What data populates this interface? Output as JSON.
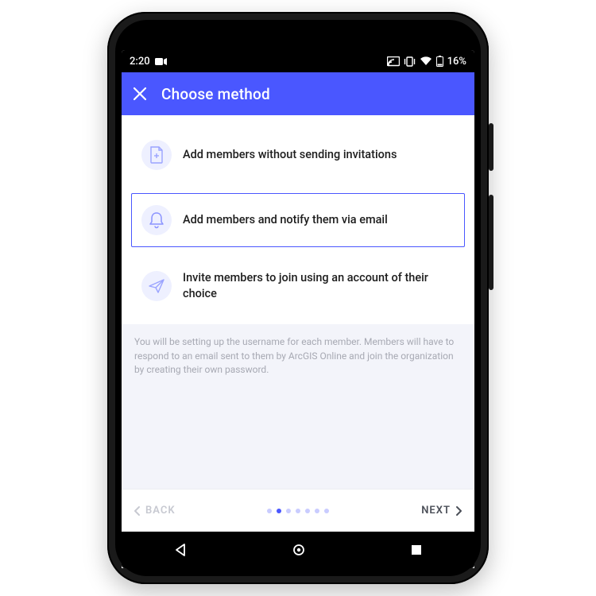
{
  "statusbar": {
    "time": "2:20",
    "battery_text": "16%"
  },
  "appbar": {
    "title": "Choose method"
  },
  "options": [
    {
      "label": "Add members without sending invitations",
      "selected": false,
      "icon": "file-plus-icon"
    },
    {
      "label": "Add members and notify them via email",
      "selected": true,
      "icon": "bell-icon"
    },
    {
      "label": "Invite members to join using an account of their choice",
      "selected": false,
      "icon": "paper-plane-icon"
    }
  ],
  "helper_text": "You will be setting up the username for each member. Members will have to respond to an email sent to them by ArcGIS Online and join the organization by creating their own password.",
  "footer": {
    "back_label": "BACK",
    "next_label": "NEXT",
    "step_count": 7,
    "active_step": 1
  }
}
